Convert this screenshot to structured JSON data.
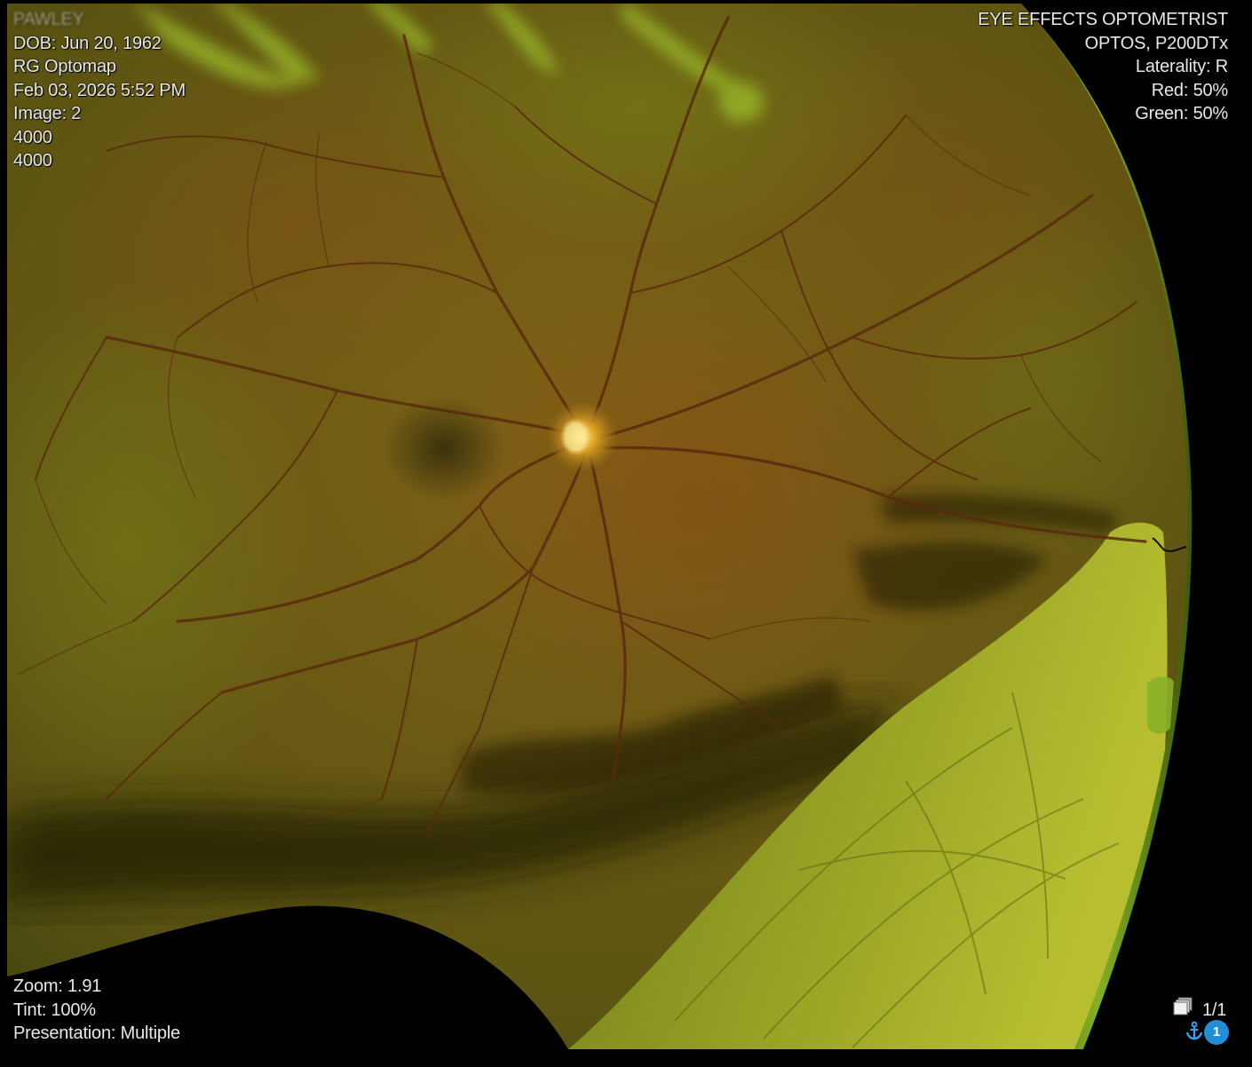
{
  "patient": {
    "name": "PAWLEY",
    "dob": "DOB: Jun 20, 1962",
    "modality": "RG Optomap",
    "acquired": "Feb 03, 2026 5:52 PM",
    "image": "Image: 2",
    "width": "4000",
    "height": "4000"
  },
  "device": {
    "institution": "EYE EFFECTS OPTOMETRIST",
    "model": "OPTOS, P200DTx",
    "laterality": "Laterality: R",
    "red": "Red: 50%",
    "green": "Green: 50%"
  },
  "view": {
    "zoom": "Zoom: 1.91",
    "tint": "Tint: 100%",
    "presentation": "Presentation: Multiple"
  },
  "navigation": {
    "frame_count": "1/1",
    "series_badge": "1",
    "stack_icon": "image-stack-icon",
    "anchor_icon": "anchor-icon"
  },
  "colors": {
    "overlay_text": "#e8e8e8",
    "badge": "#1e8fd8",
    "retina_base": "#6b5a12",
    "detached_retina": "#a6ad2a"
  }
}
